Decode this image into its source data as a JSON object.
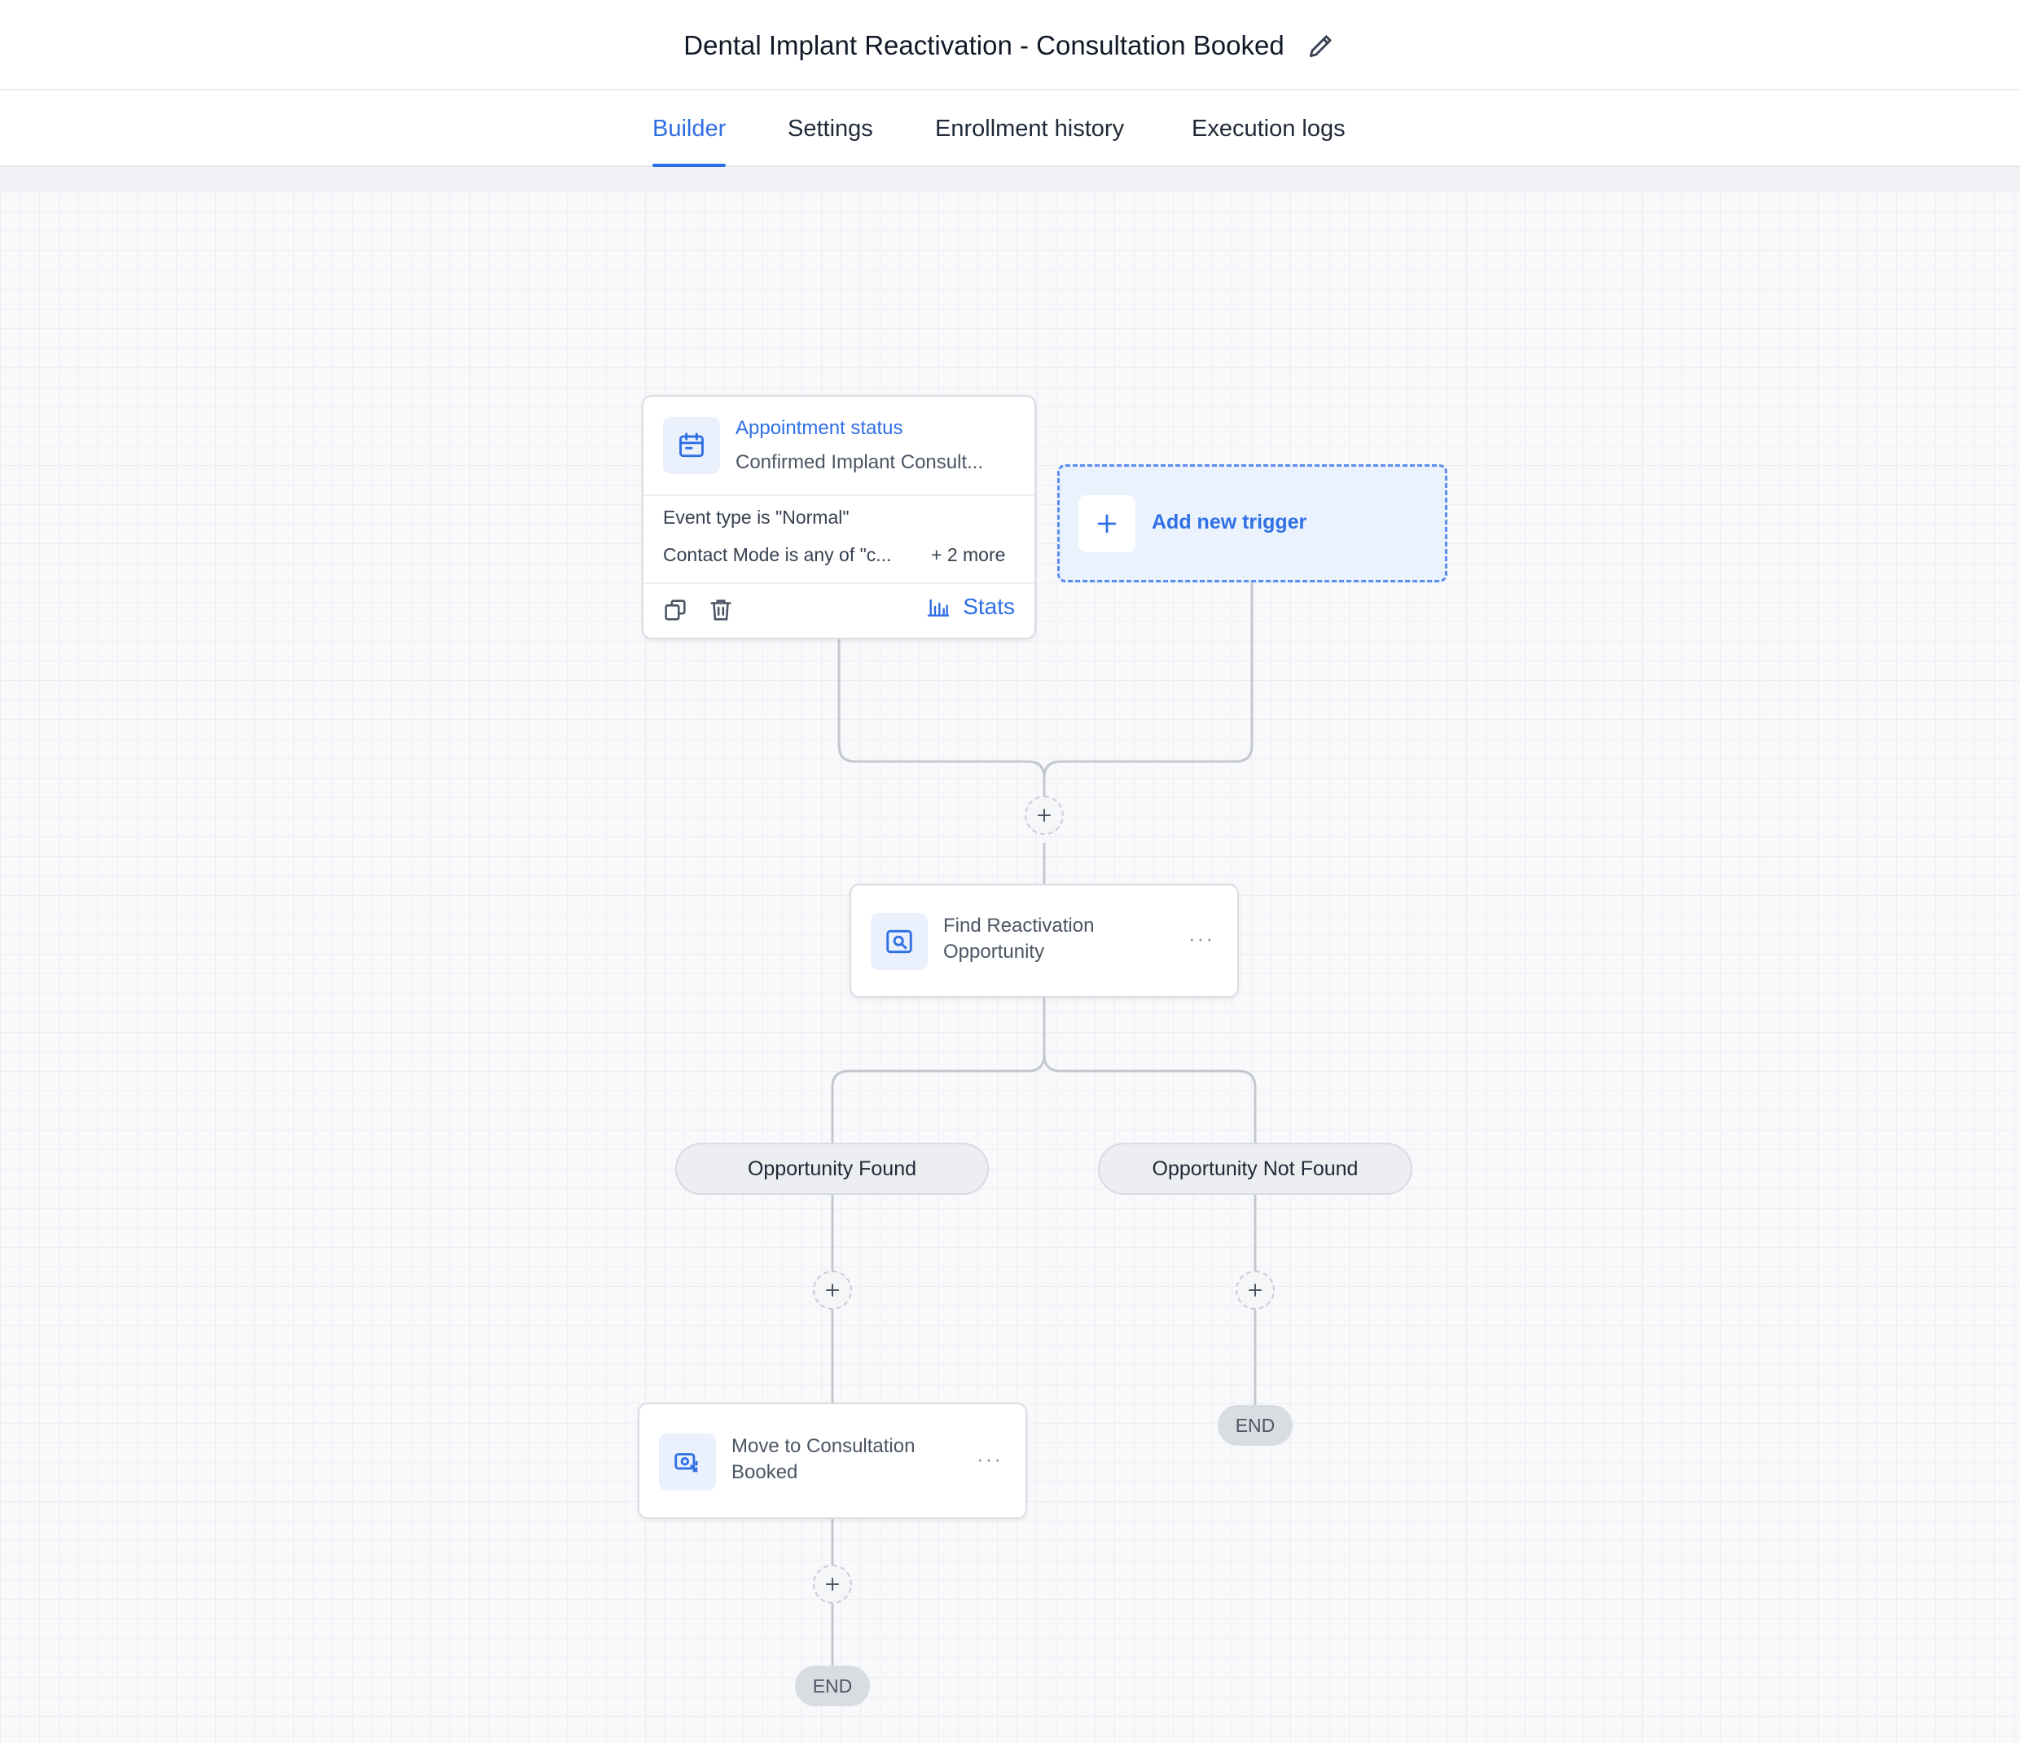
{
  "header": {
    "title": "Dental Implant Reactivation - Consultation Booked",
    "edit_icon": "pencil-icon"
  },
  "tabs": [
    {
      "label": "Builder",
      "active": true
    },
    {
      "label": "Settings",
      "active": false
    },
    {
      "label": "Enrollment history",
      "active": false
    },
    {
      "label": "Execution logs",
      "active": false
    }
  ],
  "trigger": {
    "icon": "calendar-icon",
    "title": "Appointment status",
    "subtitle": "Confirmed Implant Consult...",
    "conditions": [
      "Event type is \"Normal\"",
      "Contact Mode is any of \"c..."
    ],
    "more": "+ 2 more",
    "stats_label": "Stats",
    "copy_icon": "copy-icon",
    "delete_icon": "trash-icon",
    "stats_icon": "bar-chart-icon"
  },
  "add_trigger": {
    "label": "Add new trigger",
    "icon": "plus-icon"
  },
  "actions": [
    {
      "icon": "search-icon",
      "label": "Find Reactivation Opportunity"
    },
    {
      "icon": "opportunity-move-icon",
      "label": "Move to Consultation Booked"
    }
  ],
  "branches": [
    "Opportunity Found",
    "Opportunity Not Found"
  ],
  "end_label": "END",
  "colors": {
    "accent": "#2f6fe4",
    "connector": "#c4c8ce",
    "canvas": "#f8f9fb"
  }
}
